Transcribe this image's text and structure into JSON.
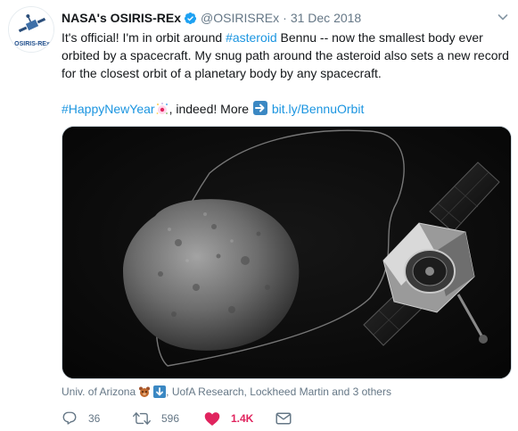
{
  "account": {
    "name": "NASA's OSIRIS-REx",
    "handle": "@OSIRISREx",
    "separator": "·",
    "date": "31 Dec 2018",
    "avatar_text": "OSIRIS-REx"
  },
  "tweet": {
    "line1_before": "It's official! I'm in orbit around ",
    "hashtag_asteroid": "#asteroid",
    "line1_after": " Bennu -- now the smallest body ever orbited by a spacecraft. My snug path around the asteroid also sets a new record for the closest orbit of a planetary body by any spacecraft.",
    "hashtag_newyear": "#HappyNewYear",
    "after_newyear": ", indeed! More ",
    "link_text": "bit.ly/BennuOrbit"
  },
  "tags": {
    "first": "Univ. of Arizona",
    "rest": ", UofA Research, Lockheed Martin and 3 others"
  },
  "actions": {
    "reply_count": "36",
    "retweet_count": "596",
    "like_count": "1.4K"
  },
  "icons": {
    "verified": "verified-badge-icon",
    "caret": "chevron-down-icon",
    "reply": "reply-icon",
    "retweet": "retweet-icon",
    "like": "heart-icon",
    "dm": "envelope-icon",
    "link_arrow": "right-arrow-emoji-icon",
    "party": "party-emoji-icon",
    "bear": "bear-emoji-icon",
    "down_arrow": "down-arrow-emoji-icon"
  },
  "colors": {
    "link": "#1b95e0",
    "like": "#e0245e",
    "verified": "#1da1f2",
    "muted": "#657786"
  }
}
